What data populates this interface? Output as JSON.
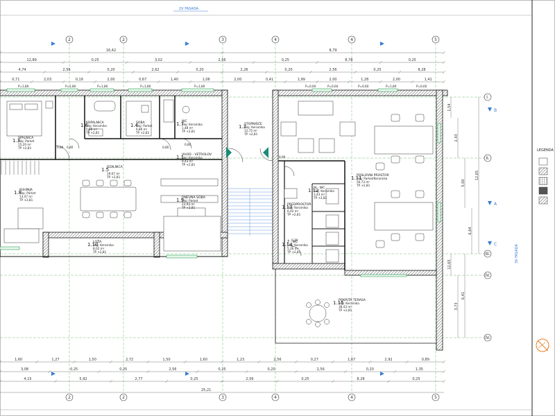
{
  "facade_labels": {
    "top": "2V FASADA",
    "right": "3V FASADA"
  },
  "legend_title": "LEGENDA",
  "axes_columns": [
    "2",
    "2",
    "3",
    "4",
    "4",
    "5"
  ],
  "axes_rows": [
    "I.",
    "II.",
    "III.",
    "IV.",
    "IV."
  ],
  "section_markers": [
    "A",
    "B",
    "C"
  ],
  "top_dims_row1": [
    "16,42",
    "8,79"
  ],
  "top_dims_row2": [
    "12,89",
    "0,25",
    "3,02",
    "2,56",
    "0,25",
    "8,78",
    "0,25"
  ],
  "top_dims_row3": [
    "4,74",
    "2,56",
    "0,20",
    "2,62",
    "0,20",
    "2,26",
    "0,20",
    "2,56",
    "0,25",
    "8,28"
  ],
  "top_dims_row4": [
    "0,71",
    "2,03",
    "0,19",
    "2,00",
    "0,67",
    "1,40",
    "1,06",
    "2,00",
    "0,41",
    "1,99",
    "2,00",
    "1,28",
    "2,00",
    "1,41"
  ],
  "bottom_dims_row1": [
    "1,60",
    "1,27",
    "1,50",
    "2,72",
    "1,50",
    "1,60",
    "1,23",
    "2,56",
    "0,27",
    "1,67",
    "2,92",
    "0,89"
  ],
  "bottom_dims_row2": [
    "3,08",
    "0,25",
    "0,25",
    "2,56",
    "0,25",
    "0,20",
    "2,56",
    "0,20",
    "1,35"
  ],
  "bottom_dims_row3": [
    "4,15",
    "5,92",
    "2,77",
    "0,25",
    "2,56",
    "0,25",
    "8,28",
    "0,25"
  ],
  "bottom_dims_total": "25,21",
  "right_dims": [
    "1,54",
    "2,43",
    "5,00",
    "6,64",
    "12,65",
    "12,65",
    "3,73",
    "6,41"
  ],
  "rooms": [
    {
      "num": "1.3",
      "name": "SPALNICA",
      "sub": "Sloj: Parket",
      "area": "15,20 m²",
      "h": "TP +2,81"
    },
    {
      "num": "1.6",
      "name": "KOPALNICA",
      "sub": "Sloj: Keramika",
      "area": "5,88 m²",
      "h": "TP +2,81"
    },
    {
      "num": "1.4",
      "name": "SOBA",
      "sub": "Sloj: Parket",
      "area": "6,80 m²",
      "h": "TP +2,81"
    },
    {
      "num": "1.7",
      "name": "WC",
      "sub": "Sloj: Keramika",
      "area": "1,48 m²",
      "h": "TP +2,81"
    },
    {
      "num": "1.1",
      "name": "VHOD - VETROLOV",
      "sub": "Sloj: Keramika",
      "area": "9,43 m²",
      "h": "TP +2,81"
    },
    {
      "num": "1.2",
      "name": "STOPNIŠČE",
      "sub": "Sloj: Keramika",
      "area": "12,75 m²",
      "h": "TP +2,81"
    },
    {
      "num": "1.5",
      "name": "JEDILNICA",
      "sub": "",
      "area": "19,67 m²",
      "h": "TP +2,81"
    },
    {
      "num": "1.8",
      "name": "KUHINJA",
      "sub": "Sloj: Parket",
      "area": "13,47 m²",
      "h": "TP +2,81"
    },
    {
      "num": "1.9",
      "name": "DNEVNA SOBA",
      "sub": "Sloj: Parket",
      "area": "23,94 m²",
      "h": "TP +2,81"
    },
    {
      "num": "1.10",
      "name": "LOŽA",
      "sub": "Sloj: Keramika",
      "area": "8,02 m²",
      "h": "TP +2,81"
    },
    {
      "num": "1.11",
      "name": "POSLOVNI PROSTOR",
      "sub": "Sloj: Parket/Keramika",
      "area": "56,73 m²",
      "h": "TP +2,81"
    },
    {
      "num": "1.12",
      "name": "M - WC",
      "sub": "Sloj: Keramika",
      "area": "3,43 m²",
      "h": "TP +2,81"
    },
    {
      "num": "1.13",
      "name": "PREDPROSTOR",
      "sub": "Sloj: Keramika",
      "area": "6,02 m²",
      "h": "TP +2,81"
    },
    {
      "num": "1.14",
      "name": "Ž - WC",
      "sub": "Sloj: Keramika",
      "area": "5,26 m²",
      "h": "TP +2,81"
    },
    {
      "num": "1.15",
      "name": "POKRITA TERASA",
      "sub": "Sloj: Keramika",
      "area": "38,43 m²",
      "h": "TP +2,81"
    }
  ],
  "window_marks": [
    "P=1,80",
    "P=1,80",
    "P=1,80",
    "P=1,80",
    "P=1,80",
    "P=0,60",
    "P=0,60",
    "P=1,80",
    "P=0,60",
    "P=0,60"
  ],
  "door_marks": [
    "0,80",
    "0,80",
    "0,80",
    "0,80",
    "0,90",
    "0,70"
  ]
}
